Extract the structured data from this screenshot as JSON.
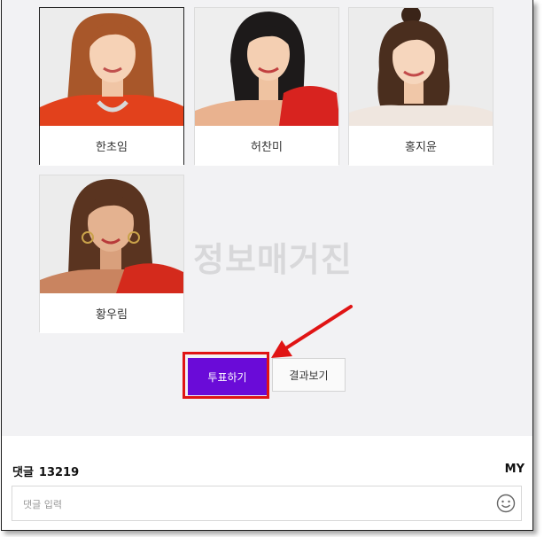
{
  "candidates": [
    {
      "name": "한초임",
      "selected": true
    },
    {
      "name": "허찬미",
      "selected": false
    },
    {
      "name": "홍지윤",
      "selected": false
    },
    {
      "name": "황우림",
      "selected": false
    }
  ],
  "watermark": "정보매거진",
  "buttons": {
    "vote": "투표하기",
    "results": "결과보기"
  },
  "comments": {
    "label": "댓글",
    "count": "13219",
    "my": "MY",
    "placeholder": "댓글 입력"
  },
  "colors": {
    "vote_button": "#6a0bd8",
    "highlight": "#e01414",
    "background": "#f2f2f4"
  },
  "icons": {
    "emoji": "smiley-icon",
    "arrow": "red-arrow-annotation"
  }
}
